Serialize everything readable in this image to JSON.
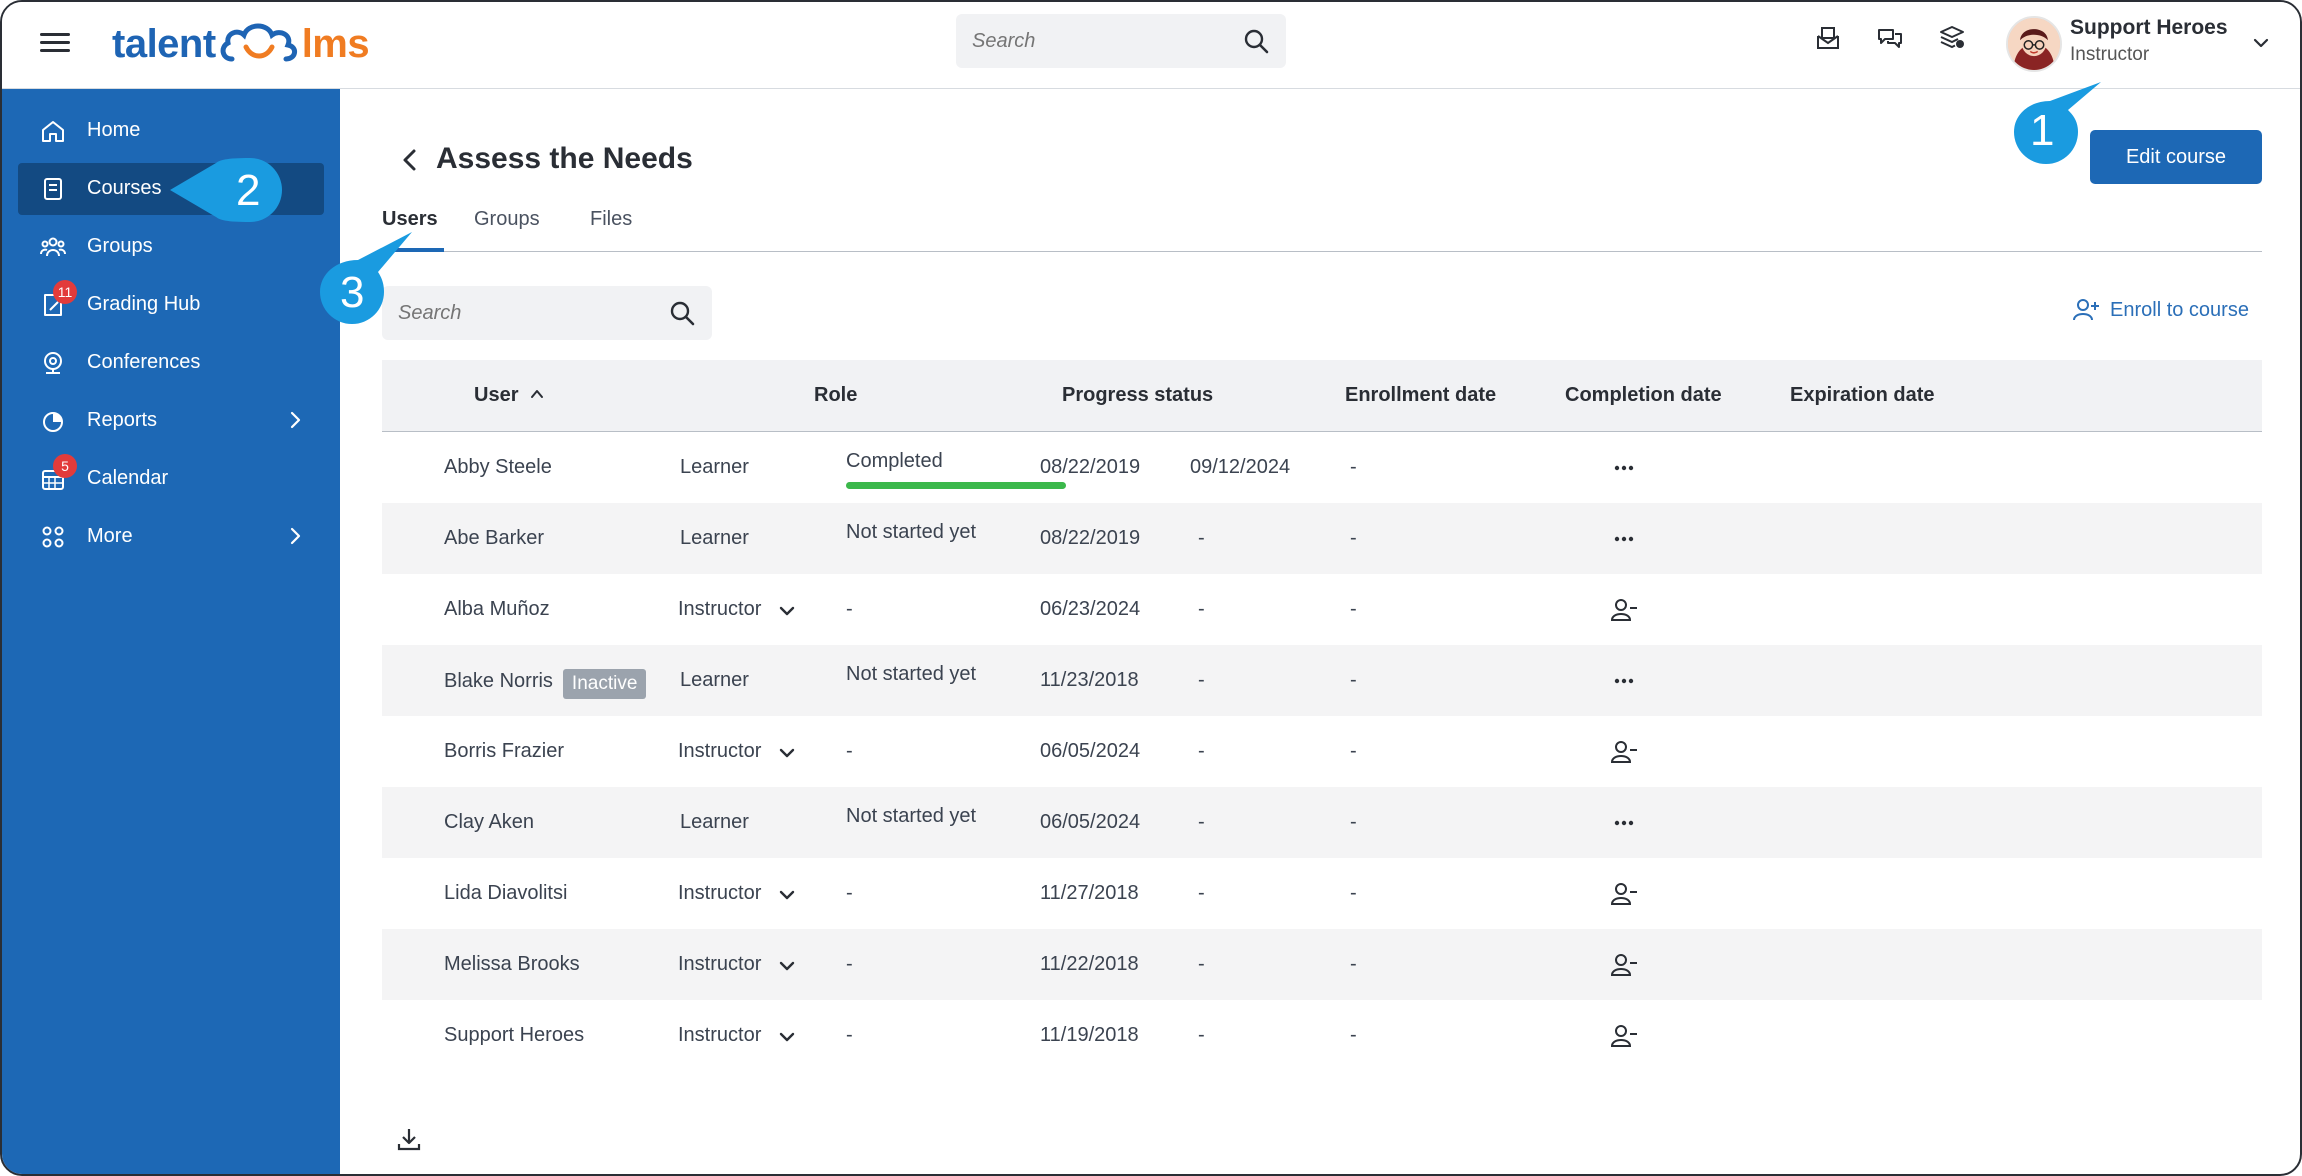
{
  "header": {
    "logo_part1": "talent",
    "logo_part2": "lms",
    "search_placeholder": "Search",
    "profile": {
      "name": "Support Heroes",
      "role": "Instructor"
    }
  },
  "sidebar": {
    "items": [
      {
        "label": "Home",
        "icon": "home-icon"
      },
      {
        "label": "Courses",
        "icon": "courses-icon",
        "active": true
      },
      {
        "label": "Groups",
        "icon": "groups-icon"
      },
      {
        "label": "Grading Hub",
        "icon": "grading-hub-icon",
        "badge": "11"
      },
      {
        "label": "Conferences",
        "icon": "conferences-icon"
      },
      {
        "label": "Reports",
        "icon": "reports-icon",
        "has_submenu": true
      },
      {
        "label": "Calendar",
        "icon": "calendar-icon",
        "badge": "5"
      },
      {
        "label": "More",
        "icon": "more-icon",
        "has_submenu": true
      }
    ]
  },
  "main": {
    "title": "Assess the Needs",
    "edit_button": "Edit course",
    "tabs": [
      {
        "label": "Users",
        "active": true
      },
      {
        "label": "Groups"
      },
      {
        "label": "Files"
      }
    ],
    "search_placeholder": "Search",
    "enroll_label": "Enroll to course"
  },
  "table": {
    "columns": [
      "User",
      "Role",
      "Progress status",
      "Enrollment date",
      "Completion date",
      "Expiration date"
    ],
    "rows": [
      {
        "user": "Abby Steele",
        "role": "Learner",
        "progress": "Completed",
        "progress_pct": 100,
        "enrolled": "08/22/2019",
        "completed": "09/12/2024",
        "expires": "-",
        "action": "more"
      },
      {
        "user": "Abe Barker",
        "role": "Learner",
        "progress": "Not started yet",
        "enrolled": "08/22/2019",
        "completed": "-",
        "expires": "-",
        "action": "more"
      },
      {
        "user": "Alba Muñoz",
        "role": "Instructor",
        "progress": "-",
        "enrolled": "06/23/2024",
        "completed": "-",
        "expires": "-",
        "action": "remove"
      },
      {
        "user": "Blake Norris",
        "badge": "Inactive",
        "role": "Learner",
        "progress": "Not started yet",
        "enrolled": "11/23/2018",
        "completed": "-",
        "expires": "-",
        "action": "more"
      },
      {
        "user": "Borris Frazier",
        "role": "Instructor",
        "progress": "-",
        "enrolled": "06/05/2024",
        "completed": "-",
        "expires": "-",
        "action": "remove"
      },
      {
        "user": "Clay Aken",
        "role": "Learner",
        "progress": "Not started yet",
        "enrolled": "06/05/2024",
        "completed": "-",
        "expires": "-",
        "action": "more"
      },
      {
        "user": "Lida Diavolitsi",
        "role": "Instructor",
        "progress": "-",
        "enrolled": "11/27/2018",
        "completed": "-",
        "expires": "-",
        "action": "remove"
      },
      {
        "user": "Melissa Brooks",
        "role": "Instructor",
        "progress": "-",
        "enrolled": "11/22/2018",
        "completed": "-",
        "expires": "-",
        "action": "remove"
      },
      {
        "user": "Support Heroes",
        "role": "Instructor",
        "progress": "-",
        "enrolled": "11/19/2018",
        "completed": "-",
        "expires": "-",
        "action": "remove"
      }
    ]
  },
  "callouts": [
    "1",
    "2",
    "3"
  ],
  "colors": {
    "sidebar": "#1d68b5",
    "sidebar_active": "#134a82",
    "callout": "#1a9be0",
    "progress": "#3bb84b",
    "badge": "#e23b3b"
  }
}
